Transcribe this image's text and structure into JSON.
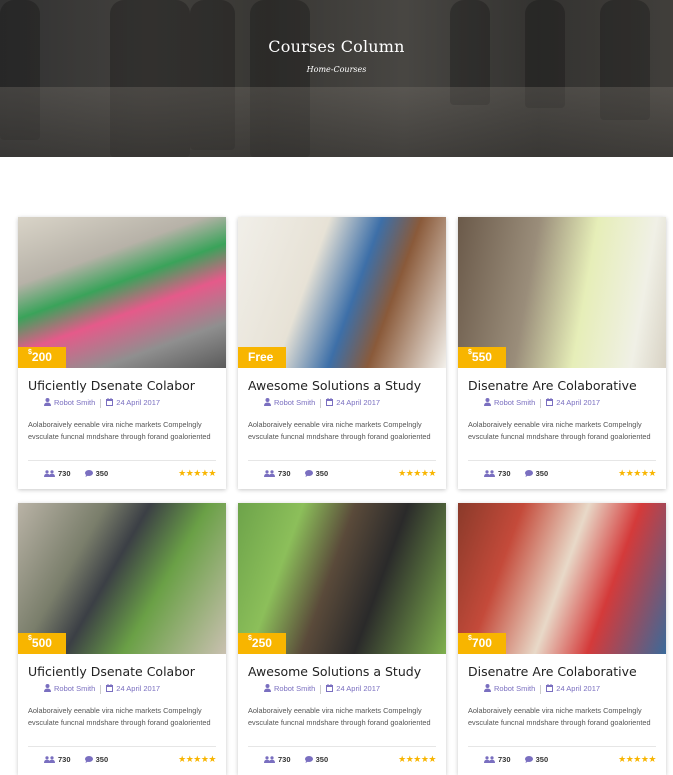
{
  "header": {
    "title": "Courses Column",
    "breadcrumb": "Home-Courses"
  },
  "courses": [
    {
      "price": "200",
      "currency": "$",
      "title": "Uficiently Dsenate Colabor",
      "author": "Robot Smith",
      "date": "24 April 2017",
      "desc": "Aolaboraively eenable vira niche markets Compelngly evsculate funcnal mndshare through forand goaloriented",
      "students": "730",
      "comments": "350",
      "rating": 5
    },
    {
      "price": "Free",
      "currency": "",
      "title": "Awesome Solutions a Study",
      "author": "Robot Smith",
      "date": "24 April 2017",
      "desc": "Aolaboraively eenable vira niche markets Compelngly evsculate funcnal mndshare through forand goaloriented",
      "students": "730",
      "comments": "350",
      "rating": 5
    },
    {
      "price": "550",
      "currency": "$",
      "title": "Disenatre Are Colaborative",
      "author": "Robot Smith",
      "date": "24 April 2017",
      "desc": "Aolaboraively eenable vira niche markets Compelngly evsculate funcnal mndshare through forand goaloriented",
      "students": "730",
      "comments": "350",
      "rating": 5
    },
    {
      "price": "500",
      "currency": "$",
      "title": "Uficiently Dsenate Colabor",
      "author": "Robot Smith",
      "date": "24 April 2017",
      "desc": "Aolaboraively eenable vira niche markets Compelngly evsculate funcnal mndshare through forand goaloriented",
      "students": "730",
      "comments": "350",
      "rating": 5
    },
    {
      "price": "250",
      "currency": "$",
      "title": "Awesome Solutions a Study",
      "author": "Robot Smith",
      "date": "24 April 2017",
      "desc": "Aolaboraively eenable vira niche markets Compelngly evsculate funcnal mndshare through forand goaloriented",
      "students": "730",
      "comments": "350",
      "rating": 5
    },
    {
      "price": "700",
      "currency": "$",
      "title": "Disenatre Are Colaborative",
      "author": "Robot Smith",
      "date": "24 April 2017",
      "desc": "Aolaboraively eenable vira niche markets Compelngly evsculate funcnal mndshare through forand goaloriented",
      "students": "730",
      "comments": "350",
      "rating": 5
    }
  ],
  "icons": {
    "author": "user-icon",
    "date": "calendar-icon",
    "students": "users-icon",
    "comments": "comment-icon",
    "rating": "star-icon"
  },
  "colors": {
    "accent": "#f8b500",
    "meta": "#7a6fc0"
  }
}
